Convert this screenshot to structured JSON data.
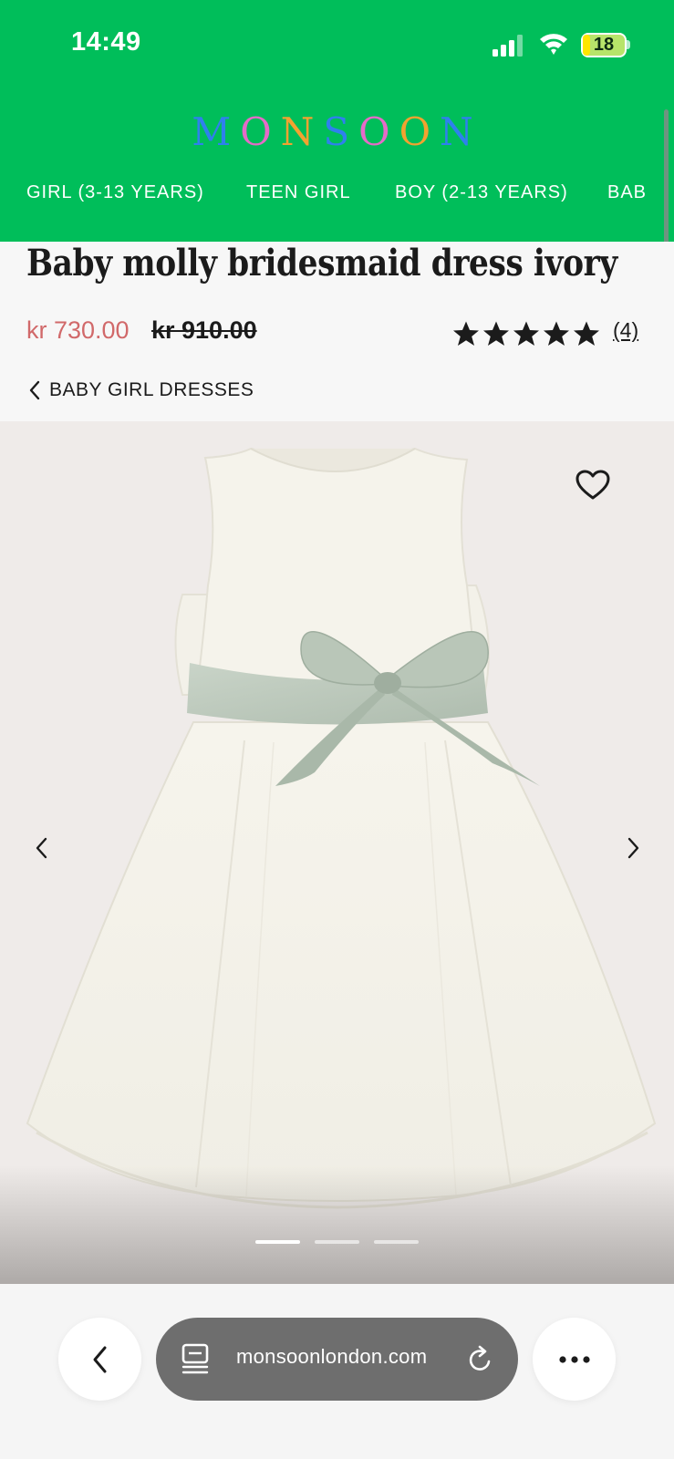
{
  "status_bar": {
    "time": "14:49",
    "battery_level": "18",
    "battery_fraction": 0.18
  },
  "header": {
    "logo_letters": [
      "M",
      "O",
      "N",
      "S",
      "O",
      "O",
      "N"
    ],
    "logo_colors": [
      "#2F80ED",
      "#E56BC8",
      "#F2A230",
      "#2F80ED",
      "#E56BC8",
      "#F2A230",
      "#2F80ED"
    ],
    "background_color": "#00BE5A",
    "categories": [
      "GIRL (3-13 YEARS)",
      "TEEN GIRL",
      "BOY (2-13 YEARS)",
      "BAB"
    ]
  },
  "product": {
    "title": "Baby molly bridesmaid dress ivory",
    "sale_price": "kr 730.00",
    "original_price": "kr 910.00",
    "rating_stars": 5,
    "review_count": "(4)",
    "breadcrumb": "BABY GIRL DRESSES",
    "sale_color": "#d1696a"
  },
  "gallery": {
    "image_subject": "ivory dress with sage green satin bow",
    "slide_count": 3,
    "active_slide": 1,
    "icons": {
      "wishlist": "heart-icon",
      "previous": "chevron-left-icon",
      "next": "chevron-right-icon"
    }
  },
  "browser": {
    "url": "monsoonlondon.com",
    "icons": {
      "back": "chevron-left-icon",
      "tabs": "tabs-icon",
      "reload": "reload-icon",
      "more": "more-icon"
    }
  }
}
